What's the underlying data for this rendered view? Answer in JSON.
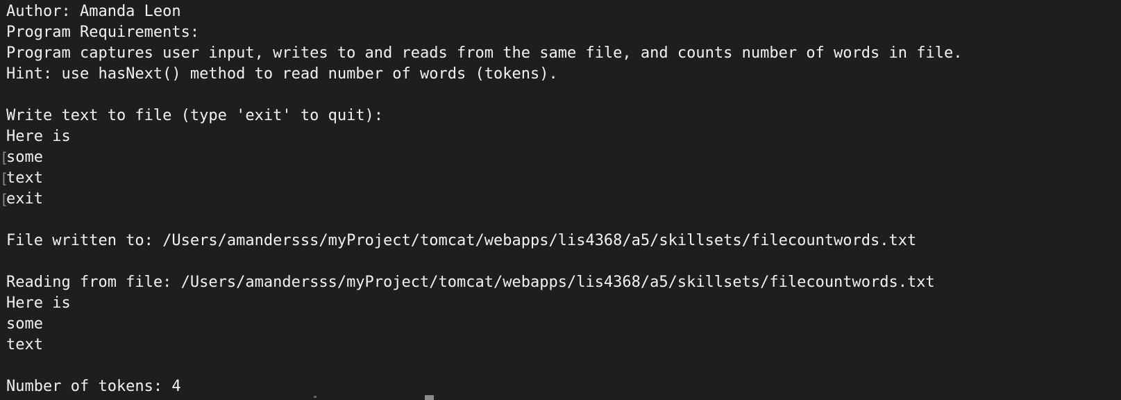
{
  "colors": {
    "background": "#1e1e1e",
    "text": "#f2f2f2",
    "prompt_marker": "#8a8a8a",
    "cursor": "#8c8c8c"
  },
  "prompt_marker_glyph": "[",
  "lines": [
    {
      "text": "Author: Amanda Leon"
    },
    {
      "text": "Program Requirements:"
    },
    {
      "text": "Program captures user input, writes to and reads from the same file, and counts number of words in file."
    },
    {
      "text": "Hint: use hasNext() method to read number of words (tokens)."
    },
    {
      "text": ""
    },
    {
      "text": "Write text to file (type 'exit' to quit):"
    },
    {
      "text": "Here is"
    },
    {
      "text": "some",
      "input_marker": true
    },
    {
      "text": "text",
      "input_marker": true
    },
    {
      "text": "exit",
      "input_marker": true
    },
    {
      "text": ""
    },
    {
      "text": "File written to: /Users/amandersss/myProject/tomcat/webapps/lis4368/a5/skillsets/filecountwords.txt"
    },
    {
      "text": ""
    },
    {
      "text": "Reading from file: /Users/amandersss/myProject/tomcat/webapps/lis4368/a5/skillsets/filecountwords.txt"
    },
    {
      "text": "Here is"
    },
    {
      "text": "some"
    },
    {
      "text": "text"
    },
    {
      "text": ""
    },
    {
      "text": "Number of tokens: 4"
    }
  ]
}
